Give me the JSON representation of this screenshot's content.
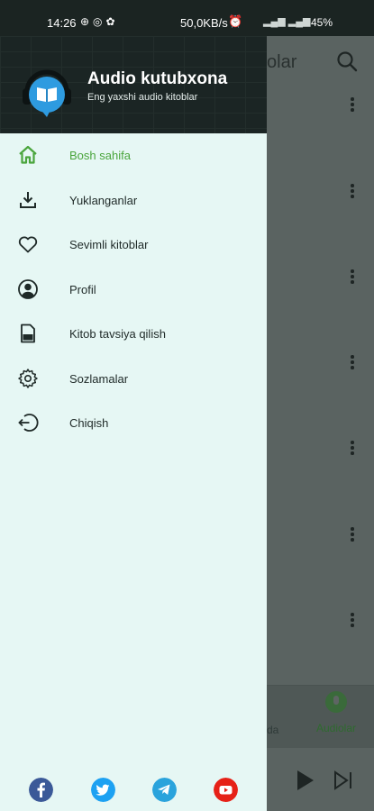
{
  "status_bar": {
    "time": "14:26",
    "network_speed": "50,0KB/s",
    "battery": "45"
  },
  "background_screen": {
    "title_partial": "olar",
    "bottom_nav_partial_label": "da",
    "bottom_nav_audio_label": "Audiolar"
  },
  "drawer": {
    "app_name": "Audio kutubxona",
    "app_subtitle": "Eng yaxshi audio kitoblar",
    "menu": [
      {
        "label": "Bosh sahifa",
        "icon": "home-icon",
        "active": true
      },
      {
        "label": "Yuklanganlar",
        "icon": "download-icon",
        "active": false
      },
      {
        "label": "Sevimli kitoblar",
        "icon": "heart-icon",
        "active": false
      },
      {
        "label": "Profil",
        "icon": "profile-icon",
        "active": false
      },
      {
        "label": "Kitob tavsiya qilish",
        "icon": "recommend-book-icon",
        "active": false
      },
      {
        "label": "Sozlamalar",
        "icon": "settings-icon",
        "active": false
      },
      {
        "label": "Chiqish",
        "icon": "logout-icon",
        "active": false
      }
    ],
    "social": [
      {
        "name": "facebook-icon",
        "color": "#3b5998"
      },
      {
        "name": "twitter-icon",
        "color": "#1da1f2"
      },
      {
        "name": "telegram-icon",
        "color": "#2aa3dc"
      },
      {
        "name": "youtube-icon",
        "color": "#e62117"
      }
    ]
  },
  "colors": {
    "accent": "#4aa53c",
    "drawer_bg": "#e6f7f4",
    "header_bg": "#1b2524"
  }
}
